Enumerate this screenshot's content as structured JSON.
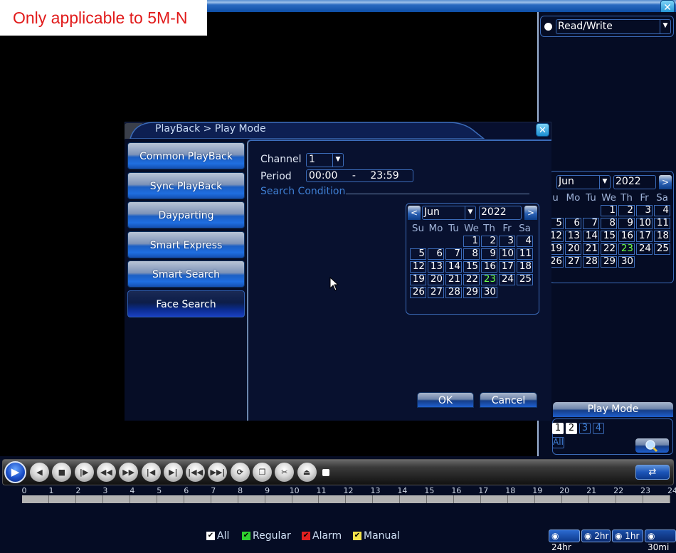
{
  "banner": {
    "note": "Only applicable to 5M-N",
    "close_label": "✕"
  },
  "right_panel": {
    "disk_mode": "Read/Write",
    "calendar": {
      "month": "Jun",
      "year": "2022",
      "next": ">",
      "weekdays": [
        "u",
        "Mo",
        "Tu",
        "We",
        "Th",
        "Fr",
        "Sa"
      ],
      "first_weekday_index": 3,
      "days_in_month": 30,
      "record_days": [
        23
      ]
    },
    "play_mode": {
      "title": "Play Mode",
      "channels": [
        {
          "label": "1",
          "selected": true
        },
        {
          "label": "2",
          "selected": true
        },
        {
          "label": "3",
          "selected": false
        },
        {
          "label": "4",
          "selected": false
        }
      ],
      "all_label": "All",
      "search_icon": "magnifier-icon"
    }
  },
  "dialog": {
    "title": "PlayBack > Play Mode",
    "close_label": "✕",
    "menu": [
      {
        "label": "Common PlayBack",
        "active": false
      },
      {
        "label": "Sync PlayBack",
        "active": false
      },
      {
        "label": "Dayparting",
        "active": false
      },
      {
        "label": "Smart Express",
        "active": false
      },
      {
        "label": "Smart Search",
        "active": false
      },
      {
        "label": "Face Search",
        "active": true
      }
    ],
    "channel_label": "Channel",
    "channel_value": "1",
    "period_label": "Period",
    "period_start": "00:00",
    "period_sep": "-",
    "period_end": "23:59",
    "search_condition": "Search Condition",
    "calendar": {
      "prev": "<",
      "next": ">",
      "month": "Jun",
      "year": "2022",
      "weekdays": [
        "Su",
        "Mo",
        "Tu",
        "We",
        "Th",
        "Fr",
        "Sa"
      ],
      "first_weekday_index": 3,
      "days_in_month": 30,
      "record_days": [
        23
      ]
    },
    "ok_label": "OK",
    "cancel_label": "Cancel"
  },
  "toolbar": {
    "buttons": [
      {
        "name": "play-icon",
        "glyph": "▶"
      },
      {
        "name": "reverse-play-icon",
        "glyph": "◀"
      },
      {
        "name": "stop-icon",
        "glyph": "■"
      },
      {
        "name": "frame-step-icon",
        "glyph": "|▶"
      },
      {
        "name": "rewind-icon",
        "glyph": "◀◀"
      },
      {
        "name": "fast-forward-icon",
        "glyph": "▶▶"
      },
      {
        "name": "previous-frame-icon",
        "glyph": "|◀"
      },
      {
        "name": "next-frame-icon",
        "glyph": "▶|"
      },
      {
        "name": "previous-file-icon",
        "glyph": "|◀◀"
      },
      {
        "name": "next-file-icon",
        "glyph": "▶▶|"
      },
      {
        "name": "loop-icon",
        "glyph": "⟳"
      },
      {
        "name": "fullscreen-icon",
        "glyph": "❐"
      },
      {
        "name": "clip-icon",
        "glyph": "✂"
      },
      {
        "name": "backup-icon",
        "glyph": "⏏"
      }
    ],
    "switch_glyph": "⇄"
  },
  "timeline": {
    "hours": [
      "0",
      "1",
      "2",
      "3",
      "4",
      "5",
      "6",
      "7",
      "8",
      "9",
      "10",
      "11",
      "12",
      "13",
      "14",
      "15",
      "16",
      "17",
      "18",
      "19",
      "20",
      "21",
      "22",
      "23",
      "24"
    ]
  },
  "legend": [
    {
      "label": "All",
      "color": "#ffffff"
    },
    {
      "label": "Regular",
      "color": "#2fd12f"
    },
    {
      "label": "Alarm",
      "color": "#e02020"
    },
    {
      "label": "Manual",
      "color": "#f2e24a"
    }
  ],
  "zoom_buttons": [
    "24hr",
    "2hr",
    "1hr",
    "30mi"
  ]
}
